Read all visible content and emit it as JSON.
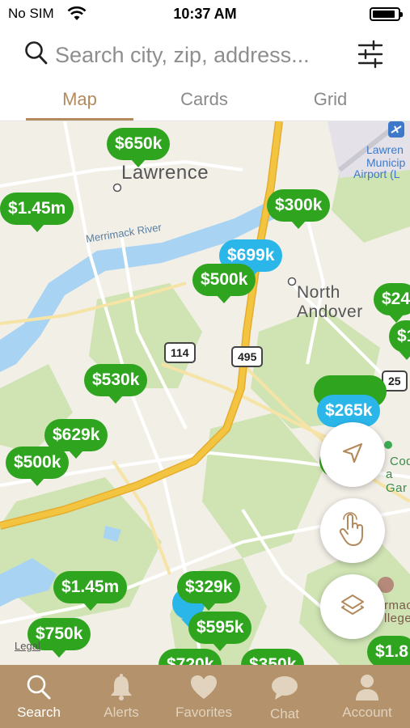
{
  "status_bar": {
    "carrier": "No SIM",
    "time": "10:37 AM",
    "battery_level": 0.8
  },
  "search": {
    "placeholder": "Search city, zip, address...",
    "value": ""
  },
  "view_tabs": {
    "selected": "Map",
    "items": [
      {
        "label": "Map"
      },
      {
        "label": "Cards"
      },
      {
        "label": "Grid"
      }
    ]
  },
  "map": {
    "places": {
      "city_lawrence": "Lawrence",
      "town_line1": "North",
      "town_line2": "Andover",
      "river": "Merrimack River",
      "airport_line1": "Lawren",
      "airport_line2": "Municip",
      "airport_line3": "Airport (L",
      "poi_right_line1": "Cod",
      "poi_right_line2": "a Gar",
      "college_line1": "rmac",
      "college_line2": "llege"
    },
    "shields": [
      "114",
      "495",
      "25"
    ],
    "legal": "Legal",
    "pins": [
      {
        "price": "$650k",
        "status": "active"
      },
      {
        "price": "$1.45m",
        "status": "active"
      },
      {
        "price": "$300k",
        "status": "active"
      },
      {
        "price": "$699k",
        "status": "new"
      },
      {
        "price": "$500k",
        "status": "active"
      },
      {
        "price": "$24",
        "status": "active"
      },
      {
        "price": "$1",
        "status": "active"
      },
      {
        "price": "$530k",
        "status": "active"
      },
      {
        "price": "$629k",
        "status": "active"
      },
      {
        "price": "$500k",
        "status": "active"
      },
      {
        "price": "$265k",
        "status": "new"
      },
      {
        "price": "$1.45m",
        "status": "active"
      },
      {
        "price": "$329k",
        "status": "active"
      },
      {
        "price": "$595k",
        "status": "active"
      },
      {
        "price": "$750k",
        "status": "active"
      },
      {
        "price": "$1.8",
        "status": "active"
      },
      {
        "price": "$720k",
        "status": "active"
      },
      {
        "price": "$350k",
        "status": "active"
      }
    ],
    "controls": [
      {
        "name": "locate",
        "icon": "location-arrow-icon"
      },
      {
        "name": "draw",
        "icon": "hand-pointer-icon"
      },
      {
        "name": "layers",
        "icon": "layers-icon"
      }
    ]
  },
  "bottom_nav": {
    "selected": "Search",
    "items": [
      {
        "label": "Search",
        "icon": "search-icon"
      },
      {
        "label": "Alerts",
        "icon": "bell-icon"
      },
      {
        "label": "Favorites",
        "icon": "heart-icon"
      },
      {
        "label": "Chat",
        "icon": "chat-bubble-icon"
      },
      {
        "label": "Account",
        "icon": "person-icon"
      }
    ]
  },
  "colors": {
    "accent": "#b38a5c",
    "tabbar_bg": "#b4926b",
    "pin_active": "#2fa41e",
    "pin_new": "#2bb6ea",
    "map_land": "#f2efe7",
    "map_water": "#a9d3f3",
    "highway": "#f3c43f"
  }
}
